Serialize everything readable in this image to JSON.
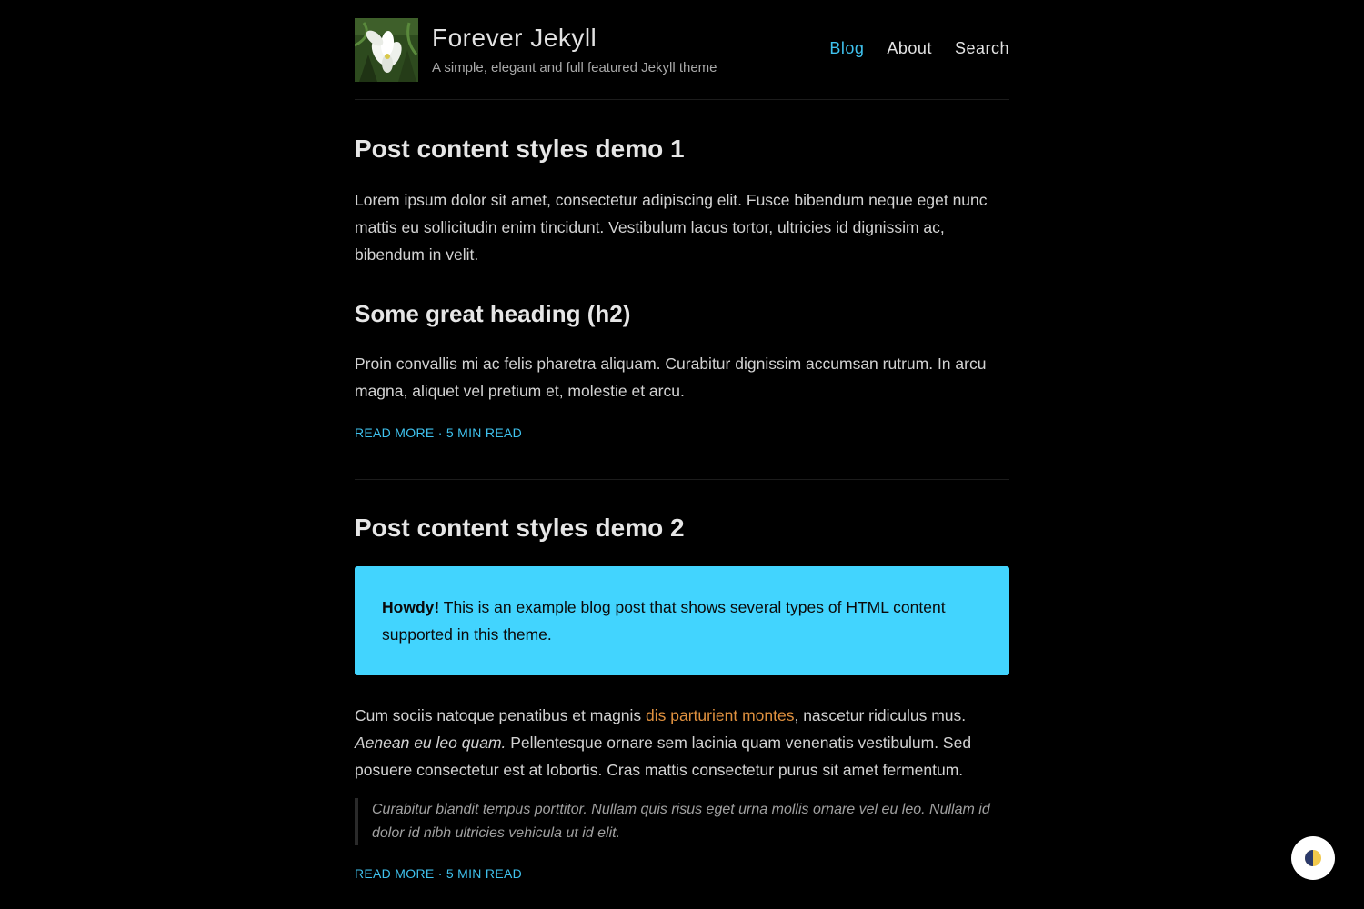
{
  "header": {
    "title": "Forever Jekyll",
    "tagline": "A simple, elegant and full featured Jekyll theme",
    "nav": [
      {
        "label": "Blog",
        "active": true
      },
      {
        "label": "About",
        "active": false
      },
      {
        "label": "Search",
        "active": false
      }
    ]
  },
  "posts": [
    {
      "title": "Post content styles demo 1",
      "paragraph1": "Lorem ipsum dolor sit amet, consectetur adipiscing elit. Fusce bibendum neque eget nunc mattis eu sollicitudin enim tincidunt. Vestibulum lacus tortor, ultricies id dignissim ac, bibendum in velit.",
      "heading": "Some great heading (h2)",
      "paragraph2": "Proin convallis mi ac felis pharetra aliquam. Curabitur dignissim accumsan rutrum. In arcu magna, aliquet vel pretium et, molestie et arcu.",
      "read_more": "READ MORE",
      "separator": "·",
      "read_time": "5 MIN READ"
    },
    {
      "title": "Post content styles demo 2",
      "notice_strong": "Howdy!",
      "notice_text": " This is an example blog post that shows several types of HTML content supported in this theme.",
      "para_start": "Cum sociis natoque penatibus et magnis ",
      "para_link": "dis parturient montes",
      "para_mid": ", nascetur ridiculus mus. ",
      "para_em": "Aenean eu leo quam.",
      "para_end": " Pellentesque ornare sem lacinia quam venenatis vestibulum. Sed posuere consectetur est at lobortis. Cras mattis consectetur purus sit amet fermentum.",
      "quote": "Curabitur blandit tempus porttitor. Nullam quis risus eget urna mollis ornare vel eu leo. Nullam id dolor id nibh ultricies vehicula ut id elit.",
      "read_more": "READ MORE",
      "separator": "·",
      "read_time": "5 MIN READ"
    }
  ],
  "theme_toggle": {
    "icon": "half-moon-icon"
  },
  "colors": {
    "background": "#000000",
    "accent": "#3fc2ee",
    "notice_bg": "#42d4fe",
    "link": "#e0913f"
  }
}
